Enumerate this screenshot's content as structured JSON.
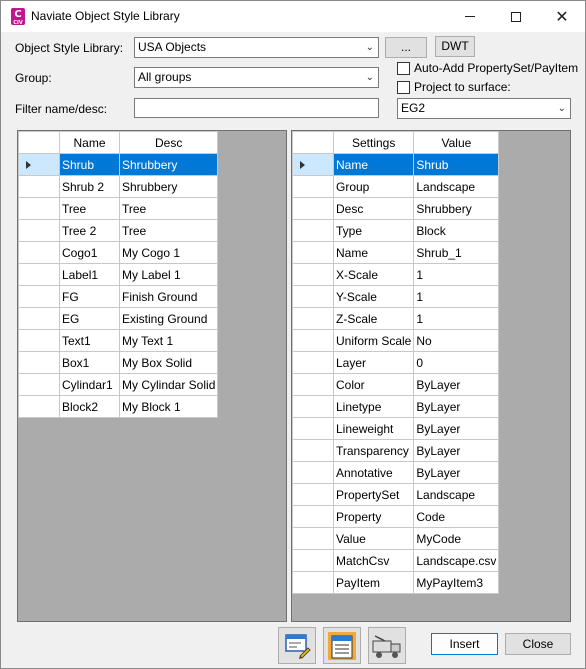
{
  "window": {
    "title": "Naviate Object Style Library",
    "icon_letter": "C",
    "icon_sub": "CIV"
  },
  "form": {
    "library_label": "Object Style Library:",
    "library_value": "USA Objects",
    "browse_label": "...",
    "dwt_label": "DWT",
    "group_label": "Group:",
    "group_value": "All groups",
    "auto_add_label": "Auto-Add PropertySet/PayItem",
    "project_label": "Project to surface:",
    "filter_label": "Filter name/desc:",
    "filter_value": "",
    "surface_value": "EG2"
  },
  "styles_grid": {
    "headers": [
      "Name",
      "Desc"
    ],
    "rows": [
      {
        "name": "Shrub",
        "desc": "Shrubbery"
      },
      {
        "name": "Shrub 2",
        "desc": "Shrubbery"
      },
      {
        "name": "Tree",
        "desc": "Tree"
      },
      {
        "name": "Tree  2",
        "desc": "Tree"
      },
      {
        "name": "Cogo1",
        "desc": "My Cogo 1"
      },
      {
        "name": "Label1",
        "desc": "My Label 1"
      },
      {
        "name": "FG",
        "desc": "Finish Ground"
      },
      {
        "name": "EG",
        "desc": "Existing Ground"
      },
      {
        "name": "Text1",
        "desc": "My Text 1"
      },
      {
        "name": "Box1",
        "desc": "My Box Solid"
      },
      {
        "name": "Cylindar1",
        "desc": "My Cylindar Solid"
      },
      {
        "name": "Block2",
        "desc": "My Block  1"
      }
    ]
  },
  "settings_grid": {
    "headers": [
      "Settings",
      "Value"
    ],
    "rows": [
      {
        "setting": "Name",
        "value": "Shrub"
      },
      {
        "setting": "Group",
        "value": "Landscape"
      },
      {
        "setting": "Desc",
        "value": "Shrubbery"
      },
      {
        "setting": "Type",
        "value": "Block"
      },
      {
        "setting": "Name",
        "value": "Shrub_1"
      },
      {
        "setting": "X-Scale",
        "value": "1"
      },
      {
        "setting": "Y-Scale",
        "value": "1"
      },
      {
        "setting": "Z-Scale",
        "value": "1"
      },
      {
        "setting": "Uniform Scale",
        "value": "No"
      },
      {
        "setting": "Layer",
        "value": "0"
      },
      {
        "setting": "Color",
        "value": "ByLayer"
      },
      {
        "setting": "Linetype",
        "value": "ByLayer"
      },
      {
        "setting": "Lineweight",
        "value": "ByLayer"
      },
      {
        "setting": "Transparency",
        "value": "ByLayer"
      },
      {
        "setting": "Annotative",
        "value": "ByLayer"
      },
      {
        "setting": "PropertySet",
        "value": "Landscape"
      },
      {
        "setting": "Property",
        "value": "Code"
      },
      {
        "setting": "Value",
        "value": "MyCode"
      },
      {
        "setting": "MatchCsv",
        "value": "Landscape.csv"
      },
      {
        "setting": "PayItem",
        "value": "MyPayItem3"
      }
    ]
  },
  "footer": {
    "insert_label": "Insert",
    "close_label": "Close"
  }
}
